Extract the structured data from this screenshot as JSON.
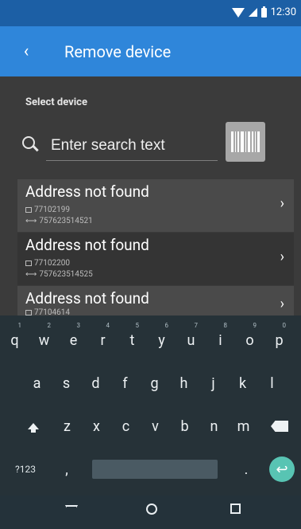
{
  "status_bar": {
    "time": "12:30"
  },
  "app_bar": {
    "back_glyph": "‹",
    "title": "Remove device"
  },
  "content": {
    "section_label": "Select device",
    "search": {
      "placeholder": "Enter search text",
      "value": ""
    },
    "devices": [
      {
        "title": "Address not found",
        "line1": "77102199",
        "line2": "757623514521"
      },
      {
        "title": "Address not found",
        "line1": "77102200",
        "line2": "757623514525"
      },
      {
        "title": "Address not found",
        "line1": "77104614",
        "line2": ""
      }
    ],
    "chevron": "›"
  },
  "keyboard": {
    "row1": [
      {
        "key": "q",
        "hint": "1"
      },
      {
        "key": "w",
        "hint": "2"
      },
      {
        "key": "e",
        "hint": "3"
      },
      {
        "key": "r",
        "hint": "4"
      },
      {
        "key": "t",
        "hint": "5"
      },
      {
        "key": "y",
        "hint": "6"
      },
      {
        "key": "u",
        "hint": "7"
      },
      {
        "key": "i",
        "hint": "8"
      },
      {
        "key": "o",
        "hint": "9"
      },
      {
        "key": "p",
        "hint": "0"
      }
    ],
    "row2": [
      "a",
      "s",
      "d",
      "f",
      "g",
      "h",
      "j",
      "k",
      "l"
    ],
    "row3": [
      "z",
      "x",
      "c",
      "v",
      "b",
      "n",
      "m"
    ],
    "symbols_label": "?123",
    "comma": ",",
    "period": ".",
    "enter_glyph": "↩"
  },
  "colors": {
    "status_bar": "#1c5fa5",
    "app_bar": "#2f86da",
    "keyboard_bg": "#263238",
    "enter_key": "#58c4b3"
  },
  "icons": [
    "wifi-icon",
    "signal-icon",
    "battery-icon",
    "back-arrow-icon",
    "search-icon",
    "barcode-icon",
    "box-icon",
    "chevron-right-icon",
    "shift-icon",
    "backspace-icon",
    "enter-icon",
    "nav-back-icon",
    "nav-home-icon",
    "nav-recents-icon"
  ]
}
